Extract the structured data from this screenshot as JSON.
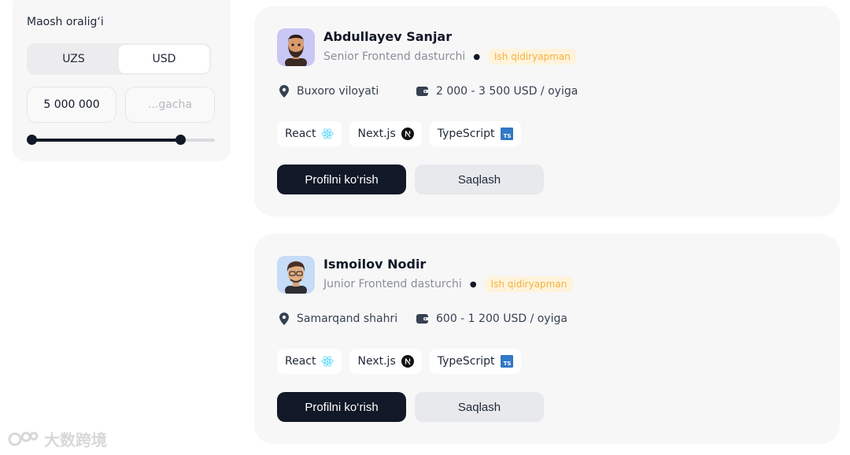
{
  "filter": {
    "title": "Maosh oralig‘i",
    "currency_options": [
      "UZS",
      "USD"
    ],
    "currency_selected": "USD",
    "salary_from": "5 000 000",
    "salary_to_placeholder": "...gacha",
    "slider_range": [
      0,
      0.81
    ]
  },
  "candidates": [
    {
      "name": "Abdullayev Sanjar",
      "role": "Senior Frontend dasturchi",
      "status": "Ish qidiryapman",
      "location": "Buxoro viloyati",
      "salary": "2 000 - 3 500 USD / oyiga",
      "skills": [
        {
          "label": "React",
          "icon": "react-icon"
        },
        {
          "label": "Next.js",
          "icon": "nextjs-icon"
        },
        {
          "label": "TypeScript",
          "icon": "typescript-icon"
        }
      ],
      "view_button": "Profilni ko‘rish",
      "save_button": "Saqlash"
    },
    {
      "name": "Ismoilov Nodir",
      "role": "Junior Frontend dasturchi",
      "status": "Ish qidiryapman",
      "location": "Samarqand shahri",
      "salary": "600 - 1 200 USD / oyiga",
      "skills": [
        {
          "label": "React",
          "icon": "react-icon"
        },
        {
          "label": "Next.js",
          "icon": "nextjs-icon"
        },
        {
          "label": "TypeScript",
          "icon": "typescript-icon"
        }
      ],
      "view_button": "Profilni ko‘rish",
      "save_button": "Saqlash"
    }
  ],
  "colors": {
    "primary": "#111827",
    "card_bg": "#f7f7f8",
    "badge_bg": "#fff3dc",
    "badge_text": "#f2b33d",
    "react": "#61dafb",
    "typescript": "#3178c6"
  },
  "watermark": "大数跨境"
}
